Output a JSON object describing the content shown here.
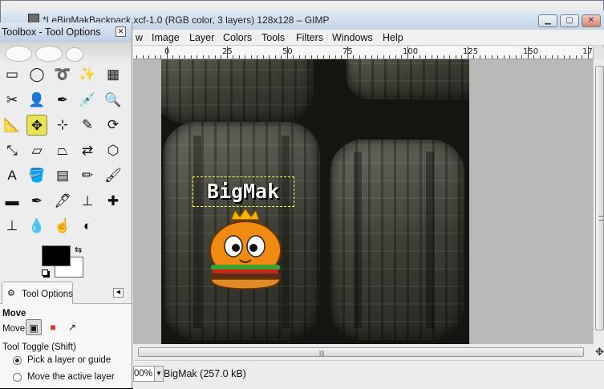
{
  "main_window": {
    "title": "*LeBigMakBackpack.xcf-1.0 (RGB color, 3 layers) 128x128 – GIMP",
    "menus": [
      "w",
      "Image",
      "Layer",
      "Colors",
      "Tools",
      "Filters",
      "Windows",
      "Help"
    ],
    "ruler_labels": [
      "0",
      "25",
      "50",
      "75",
      "100",
      "125",
      "150",
      "17"
    ],
    "zoom": "00%",
    "status": "BigMak (257.0 kB)",
    "canvas_text": "BigMak"
  },
  "toolbox": {
    "title": "Toolbox - Tool Options",
    "tools": [
      {
        "name": "rect-select-tool-icon",
        "glyph": "▭"
      },
      {
        "name": "ellipse-select-tool-icon",
        "glyph": "◯"
      },
      {
        "name": "free-select-tool-icon",
        "glyph": "➰"
      },
      {
        "name": "fuzzy-select-tool-icon",
        "glyph": "✨"
      },
      {
        "name": "select-by-color-tool-icon",
        "glyph": "▦"
      },
      {
        "name": "scissors-tool-icon",
        "glyph": "✂"
      },
      {
        "name": "foreground-select-tool-icon",
        "glyph": "👤"
      },
      {
        "name": "paths-tool-icon",
        "glyph": "✒"
      },
      {
        "name": "color-picker-tool-icon",
        "glyph": "💉"
      },
      {
        "name": "zoom-tool-icon",
        "glyph": "🔍"
      },
      {
        "name": "measure-tool-icon",
        "glyph": "📐"
      },
      {
        "name": "move-tool-icon",
        "glyph": "✥"
      },
      {
        "name": "align-tool-icon",
        "glyph": "⊹"
      },
      {
        "name": "crop-tool-icon",
        "glyph": "✎"
      },
      {
        "name": "rotate-tool-icon",
        "glyph": "⟳"
      },
      {
        "name": "scale-tool-icon",
        "glyph": "⤡"
      },
      {
        "name": "shear-tool-icon",
        "glyph": "▱"
      },
      {
        "name": "perspective-tool-icon",
        "glyph": "⏢"
      },
      {
        "name": "flip-tool-icon",
        "glyph": "⇄"
      },
      {
        "name": "cage-transform-tool-icon",
        "glyph": "⬡"
      },
      {
        "name": "text-tool-icon",
        "glyph": "A"
      },
      {
        "name": "bucket-fill-tool-icon",
        "glyph": "🪣"
      },
      {
        "name": "blend-tool-icon",
        "glyph": "▤"
      },
      {
        "name": "pencil-tool-icon",
        "glyph": "✏"
      },
      {
        "name": "paintbrush-tool-icon",
        "glyph": "🖌"
      },
      {
        "name": "eraser-tool-icon",
        "glyph": "▬"
      },
      {
        "name": "airbrush-tool-icon",
        "glyph": "✒"
      },
      {
        "name": "ink-tool-icon",
        "glyph": "🖋"
      },
      {
        "name": "clone-tool-icon",
        "glyph": "⊥"
      },
      {
        "name": "heal-tool-icon",
        "glyph": "✚"
      },
      {
        "name": "perspective-clone-tool-icon",
        "glyph": "⊥"
      },
      {
        "name": "blur-tool-icon",
        "glyph": "💧"
      },
      {
        "name": "smudge-tool-icon",
        "glyph": "☝"
      },
      {
        "name": "dodge-burn-tool-icon",
        "glyph": "◐"
      }
    ],
    "active_tool": "move-tool-icon",
    "fg_color": "#000000",
    "bg_color": "#ffffff",
    "tab_label": "Tool Options",
    "options": {
      "header": "Move",
      "move_label": "Move:",
      "move_modes": [
        {
          "name": "move-layer-mode-icon",
          "glyph": "▣",
          "selected": true
        },
        {
          "name": "move-selection-mode-icon",
          "glyph": "■",
          "selected": false
        },
        {
          "name": "move-path-mode-icon",
          "glyph": "↗",
          "selected": false
        }
      ],
      "tool_toggle": "Tool Toggle  (Shift)",
      "radio_options": [
        {
          "label": "Pick a layer or guide",
          "checked": true
        },
        {
          "label": "Move the active layer",
          "checked": false
        }
      ]
    }
  },
  "colors": {
    "accent_active_tool": "#e8e35a",
    "titlebar": "#c3d3e6"
  }
}
